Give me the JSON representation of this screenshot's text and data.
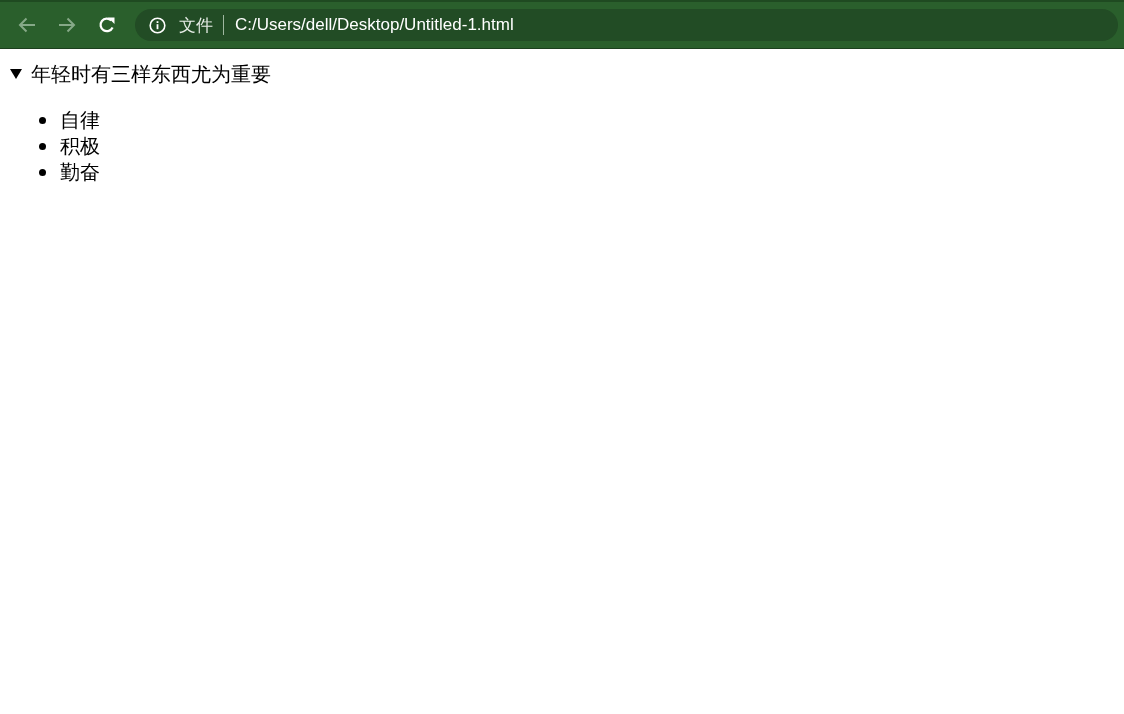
{
  "browser": {
    "nav_buttons": [
      {
        "kind": "back",
        "disabled": true
      },
      {
        "kind": "forward",
        "disabled": true
      },
      {
        "kind": "reload",
        "disabled": false
      }
    ],
    "address": {
      "scheme_label": "文件",
      "url": "C:/Users/dell/Desktop/Untitled-1.html"
    }
  },
  "details": {
    "summary": "年轻时有三样东西尤为重要",
    "expanded": true,
    "items": [
      "自律",
      "积极",
      "勤奋"
    ]
  }
}
